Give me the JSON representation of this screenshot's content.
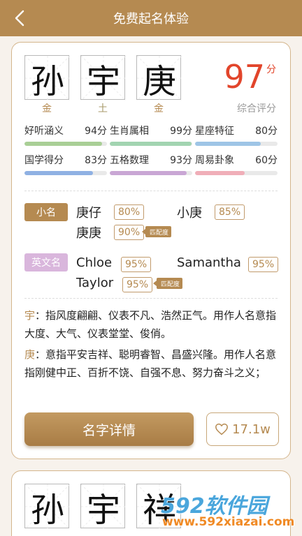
{
  "header": {
    "title": "免费起名体验"
  },
  "card": {
    "name_chars": [
      {
        "char": "孙",
        "element": "金"
      },
      {
        "char": "宇",
        "element": "土"
      },
      {
        "char": "庚",
        "element": "金"
      }
    ],
    "score": {
      "value": "97",
      "unit": "分",
      "label": "综合评分"
    },
    "metrics": [
      {
        "label": "好听涵义",
        "value": "94分",
        "percent": 94,
        "color": "#a9cf96"
      },
      {
        "label": "生肖属相",
        "value": "99分",
        "percent": 99,
        "color": "#a2d4b1"
      },
      {
        "label": "星座特征",
        "value": "80分",
        "percent": 80,
        "color": "#9ec5e6"
      },
      {
        "label": "国学得分",
        "value": "83分",
        "percent": 83,
        "color": "#8fb1e3"
      },
      {
        "label": "五格数理",
        "value": "93分",
        "percent": 93,
        "color": "#c9a6d4"
      },
      {
        "label": "周易卦象",
        "value": "60分",
        "percent": 60,
        "color": "#f0aeb8"
      }
    ],
    "nickname": {
      "tag": "小名",
      "tag_color": "#b58a51",
      "items": [
        {
          "name": "庚仔",
          "pct": "80%"
        },
        {
          "name": "小庚",
          "pct": "85%"
        },
        {
          "name": "庚庚",
          "pct": "90%"
        }
      ],
      "match_label": "匹配度"
    },
    "english": {
      "tag": "英文名",
      "tag_color": "#d9b6dc",
      "items": [
        {
          "name": "Chloe",
          "pct": "95%"
        },
        {
          "name": "Samantha",
          "pct": "95%"
        },
        {
          "name": "Taylor",
          "pct": "95%"
        }
      ],
      "match_label": "匹配度"
    },
    "meanings": [
      {
        "key": "宇",
        "text": "：指风度翩翩、仪表不凡、浩然正气。用作人名意指大度、大气、仪表堂堂、俊俏。"
      },
      {
        "key": "庚",
        "text": "：意指平安吉祥、聪明睿智、昌盛兴隆。用作人名意指刚健中正、百折不饶、自强不息、努力奋斗之义；"
      }
    ],
    "detail_button": "名字详情",
    "like_count": "17.1w"
  },
  "card2": {
    "name_chars": [
      {
        "char": "孙"
      },
      {
        "char": "宇"
      },
      {
        "char": "祥"
      }
    ]
  },
  "watermark": {
    "brand": "592软件园",
    "url": "www.592xiazai.com"
  }
}
